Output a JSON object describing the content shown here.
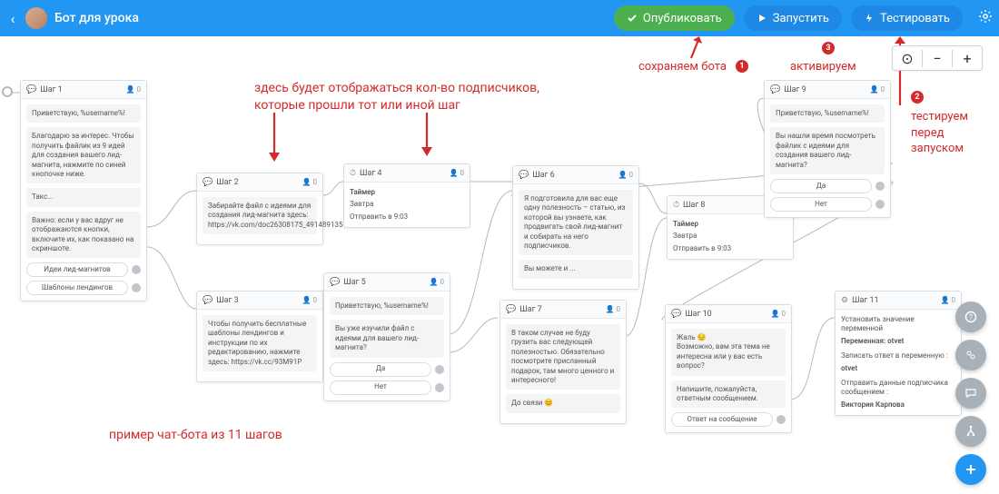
{
  "header": {
    "title": "Бот для урока",
    "publish": "Опубликовать",
    "launch": "Запустить",
    "test": "Тестировать"
  },
  "annotations": {
    "subscribers_line1": "здесь будет отображаться кол-во подписчиков,",
    "subscribers_line2": "которые прошли тот или иной шаг",
    "example": "пример чат-бота из 11 шагов",
    "save": "сохраняем бота",
    "activate": "активируем",
    "test_before1": "тестируем",
    "test_before2": "перед",
    "test_before3": "запуском",
    "num1": "1",
    "num2": "2",
    "num3": "3"
  },
  "steps": {
    "s1": {
      "name": "Шаг 1",
      "count": "0",
      "msg1": "Приветствую, %username%!",
      "msg2": "Благодарю за интерес. Чтобы получить файлик из 9 идей для создания вашего лид-магнита, нажмите по синей кнопочке ниже.",
      "msg3": "Такс...",
      "msg4": "Важно: если у вас вдруг не отображаются кнопки, включите их, как показано на скриншоте.",
      "btn1": "Идеи лид-магнитов",
      "btn2": "Шаблоны лендингов"
    },
    "s2": {
      "name": "Шаг 2",
      "count": "0",
      "msg1": "Забирайте файл с идеями для создания лид-магнита здесь: https://vk.com/doc26308175_491489135"
    },
    "s3": {
      "name": "Шаг 3",
      "count": "0",
      "msg1": "Чтобы получить бесплатные шаблоны лендингов и инструкции по их редактированию, нажмите здесь: https://vk.cc/93M91P"
    },
    "s4": {
      "name": "Шаг 4",
      "count": "0",
      "t1": "Таймер",
      "t2": "Завтра",
      "t3": "Отправить в 9:03"
    },
    "s5": {
      "name": "Шаг 5",
      "count": "0",
      "msg1": "Приветствую, %username%!",
      "msg2": "Вы уже изучили файл с идеями для вашего лид-магнита?",
      "btn1": "Да",
      "btn2": "Нет"
    },
    "s6": {
      "name": "Шаг 6",
      "count": "0",
      "msg1": "Я подготовила для вас еще одну полезность – статью, из которой вы узнаете, как продвигать свой лид-магнит и собирать на него подписчиков.",
      "msg2": "Вы можете и ..."
    },
    "s7": {
      "name": "Шаг 7",
      "count": "0",
      "msg1": "В таком случае не буду грузить вас следующей полезностью. Обязательно посмотрите присланный подарок, там много ценного и интересного!",
      "msg2": "До связи 😊"
    },
    "s8": {
      "name": "Шаг 8",
      "count": "0",
      "t1": "Таймер",
      "t2": "Завтра",
      "t3": "Отправить в 9:03"
    },
    "s9": {
      "name": "Шаг 9",
      "count": "0",
      "msg1": "Приветствую, %username%!",
      "msg2": "Вы нашли время посмотреть файлик с идеями для создания вашего лид-магнита?",
      "btn1": "Да",
      "btn2": "Нет"
    },
    "s10": {
      "name": "Шаг 10",
      "count": "0",
      "msg1": "Жаль 😔",
      "msg2": "Возможно, вам эта тема не интересна или у вас есть вопрос?",
      "msg3": "Напишите, пожалуйста, ответным сообщением.",
      "btn1": "Ответ на сообщение"
    },
    "s11": {
      "name": "Шаг 11",
      "count": "0",
      "l1": "Установить значение переменной",
      "l2": "Переменная: otvet",
      "l3": "Записать ответ в переменную :",
      "l4": "otvet",
      "l5": "Отправить данные подписчика сообщением :",
      "l6": "Виктория Карпова"
    }
  }
}
